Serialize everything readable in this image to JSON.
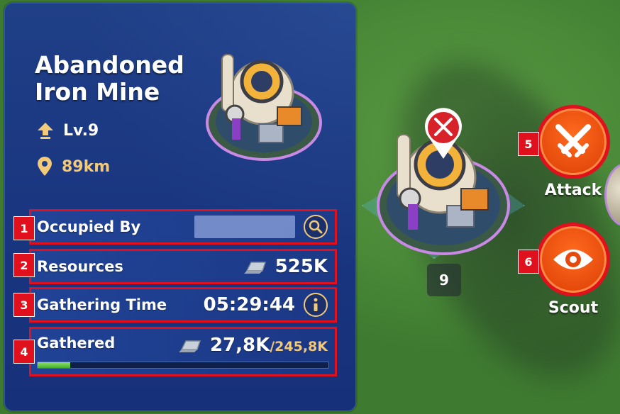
{
  "panel": {
    "title_line1": "Abandoned",
    "title_line2": "Iron Mine",
    "level": "Lv.9",
    "distance": "89km",
    "icons": {
      "level": "upgrade-arrow-icon",
      "distance": "location-pin-icon"
    }
  },
  "rows": {
    "occupied_by": {
      "badge": "1",
      "label": "Occupied By",
      "icon": "search-icon"
    },
    "resources": {
      "badge": "2",
      "label": "Resources",
      "value": "525K",
      "icon": "iron-ingot-icon"
    },
    "gathering_time": {
      "badge": "3",
      "label": "Gathering Time",
      "value": "05:29:44",
      "icon": "info-icon"
    },
    "gathered": {
      "badge": "4",
      "label": "Gathered",
      "value": "27,8K",
      "total": "/245,8K",
      "icon": "iron-ingot-icon",
      "progress": 0.113
    }
  },
  "map": {
    "building_level": "9",
    "attack": {
      "badge": "5",
      "label": "Attack",
      "icon": "crossed-swords-icon"
    },
    "scout": {
      "badge": "6",
      "label": "Scout",
      "icon": "eye-icon"
    }
  },
  "colors": {
    "panel_bg": "#1f3f87",
    "highlight_red": "#e0101c",
    "gold_text": "#f3c97a",
    "action_orange": "#ff6a1e",
    "progress_green": "#46b12d"
  }
}
